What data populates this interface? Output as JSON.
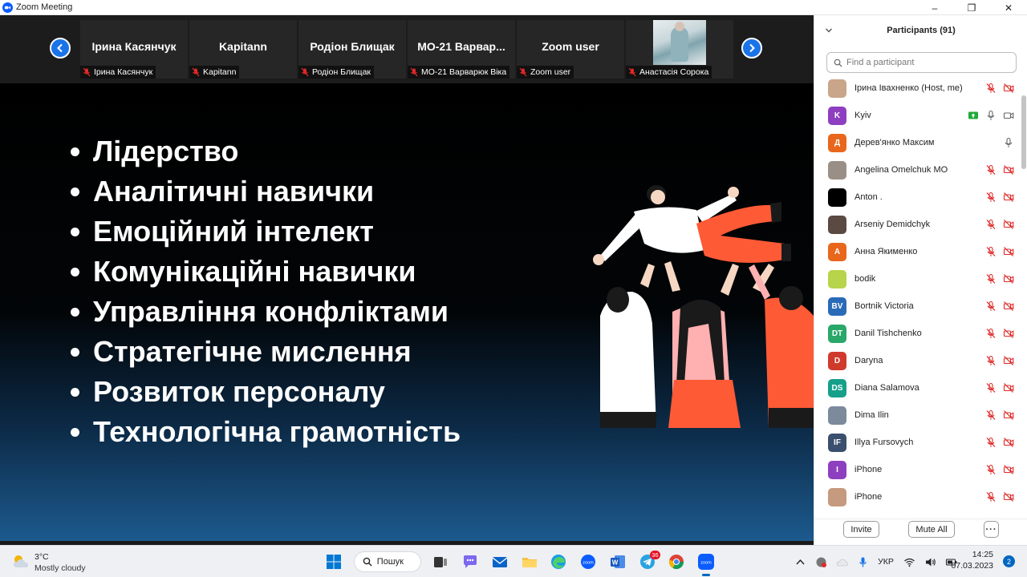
{
  "window": {
    "title": "Zoom Meeting",
    "minimize": "–",
    "maximize": "❐",
    "close": "✕"
  },
  "strip": {
    "tiles": [
      {
        "name": "Ірина Касянчук",
        "label": "Ірина Касянчук"
      },
      {
        "name": "Kapitann",
        "label": "Kapitann"
      },
      {
        "name": "Родіон Блищак",
        "label": "Родіон Блищак"
      },
      {
        "name": "МО-21  Варвар...",
        "label": "МО-21 Варварюк Віка"
      },
      {
        "name": "Zoom user",
        "label": "Zoom user"
      },
      {
        "name": "",
        "label": "Анастасія Сорока"
      }
    ]
  },
  "slide": {
    "bullets": [
      "Лідерство",
      "Аналітичні навички",
      "Емоційний інтелект",
      "Комунікаційні навички",
      "Управління конфліктами",
      "Стратегічне мислення",
      "Розвиток персоналу",
      "Технологічна грамотність"
    ]
  },
  "panel": {
    "title": "Participants (91)",
    "search_placeholder": "Find a participant",
    "invite": "Invite",
    "mute_all": "Mute All",
    "more": "···",
    "participants": [
      {
        "name": "Ірина Івахненко (Host, me)",
        "avatar": "",
        "color": "#c9a58a",
        "icons": "muted"
      },
      {
        "name": "Kyiv",
        "avatar": "K",
        "color": "#8e3fc0",
        "icons": "share"
      },
      {
        "name": "Дерев'янко Максим",
        "avatar": "Д",
        "color": "#e8671c",
        "icons": "mic"
      },
      {
        "name": "Angelina Omelchuk МО",
        "avatar": "",
        "color": "#9a8f86",
        "icons": "muted"
      },
      {
        "name": "Anton .",
        "avatar": "",
        "color": "#000000",
        "icons": "muted"
      },
      {
        "name": "Arseniy Demidchyk",
        "avatar": "",
        "color": "#5a4a42",
        "icons": "muted"
      },
      {
        "name": "Анна Якименко",
        "avatar": "А",
        "color": "#e8671c",
        "icons": "muted"
      },
      {
        "name": "bodik",
        "avatar": "",
        "color": "#b7d44a",
        "icons": "muted"
      },
      {
        "name": "Bortnik Victoria",
        "avatar": "BV",
        "color": "#2a6bb8",
        "icons": "muted"
      },
      {
        "name": "Danil Tishchenko",
        "avatar": "DT",
        "color": "#2aa86a",
        "icons": "muted"
      },
      {
        "name": "Daryna",
        "avatar": "D",
        "color": "#d03a2c",
        "icons": "muted"
      },
      {
        "name": "Diana Salamova",
        "avatar": "DS",
        "color": "#16a08a",
        "icons": "muted"
      },
      {
        "name": "Dima Ilin",
        "avatar": "",
        "color": "#7d8a9c",
        "icons": "muted"
      },
      {
        "name": "Illya Fursovych",
        "avatar": "IF",
        "color": "#3b4f6e",
        "icons": "muted"
      },
      {
        "name": "iPhone",
        "avatar": "I",
        "color": "#8e3fc0",
        "icons": "muted"
      },
      {
        "name": "iPhone",
        "avatar": "",
        "color": "#c69a7e",
        "icons": "muted"
      }
    ]
  },
  "taskbar": {
    "weather_temp": "3°C",
    "weather_cond": "Mostly cloudy",
    "search_label": "Пошук",
    "telegram_badge": "36",
    "lang": "УКР",
    "time": "14:25",
    "date": "07.03.2023",
    "notifications": "2"
  },
  "colors": {
    "accent": "#0b5cff",
    "muted_red": "#e02828",
    "taskbar_bg": "#eef0f4"
  }
}
